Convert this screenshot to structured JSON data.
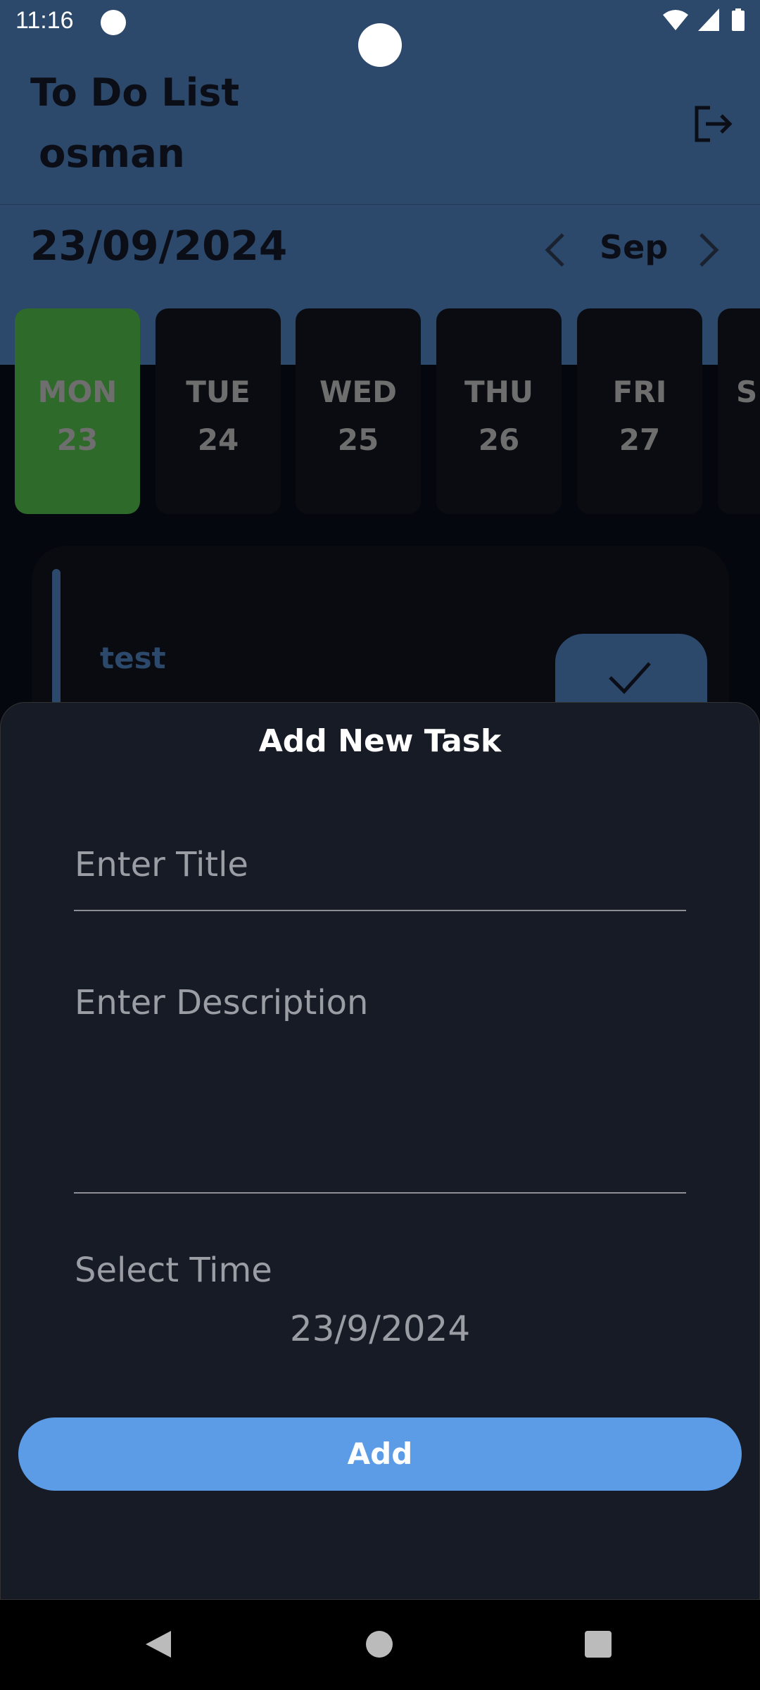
{
  "status_bar": {
    "time": "11:16"
  },
  "header": {
    "title": "To Do List",
    "username": "osman",
    "selected_date": "23/09/2024",
    "month": "Sep"
  },
  "days": [
    {
      "name": "MON",
      "num": "23"
    },
    {
      "name": "TUE",
      "num": "24"
    },
    {
      "name": "WED",
      "num": "25"
    },
    {
      "name": "THU",
      "num": "26"
    },
    {
      "name": "FRI",
      "num": "27"
    },
    {
      "name": "S",
      "num": ""
    }
  ],
  "task": {
    "title": "test"
  },
  "sheet": {
    "title": "Add New Task",
    "title_placeholder": "Enter Title",
    "description_placeholder": "Enter Description",
    "time_label": "Select Time",
    "time_value": "23/9/2024",
    "add_label": "Add"
  },
  "colors": {
    "header": "#2c486b",
    "selected_day": "#2e6a2a",
    "add_button": "#5c9ce6"
  }
}
